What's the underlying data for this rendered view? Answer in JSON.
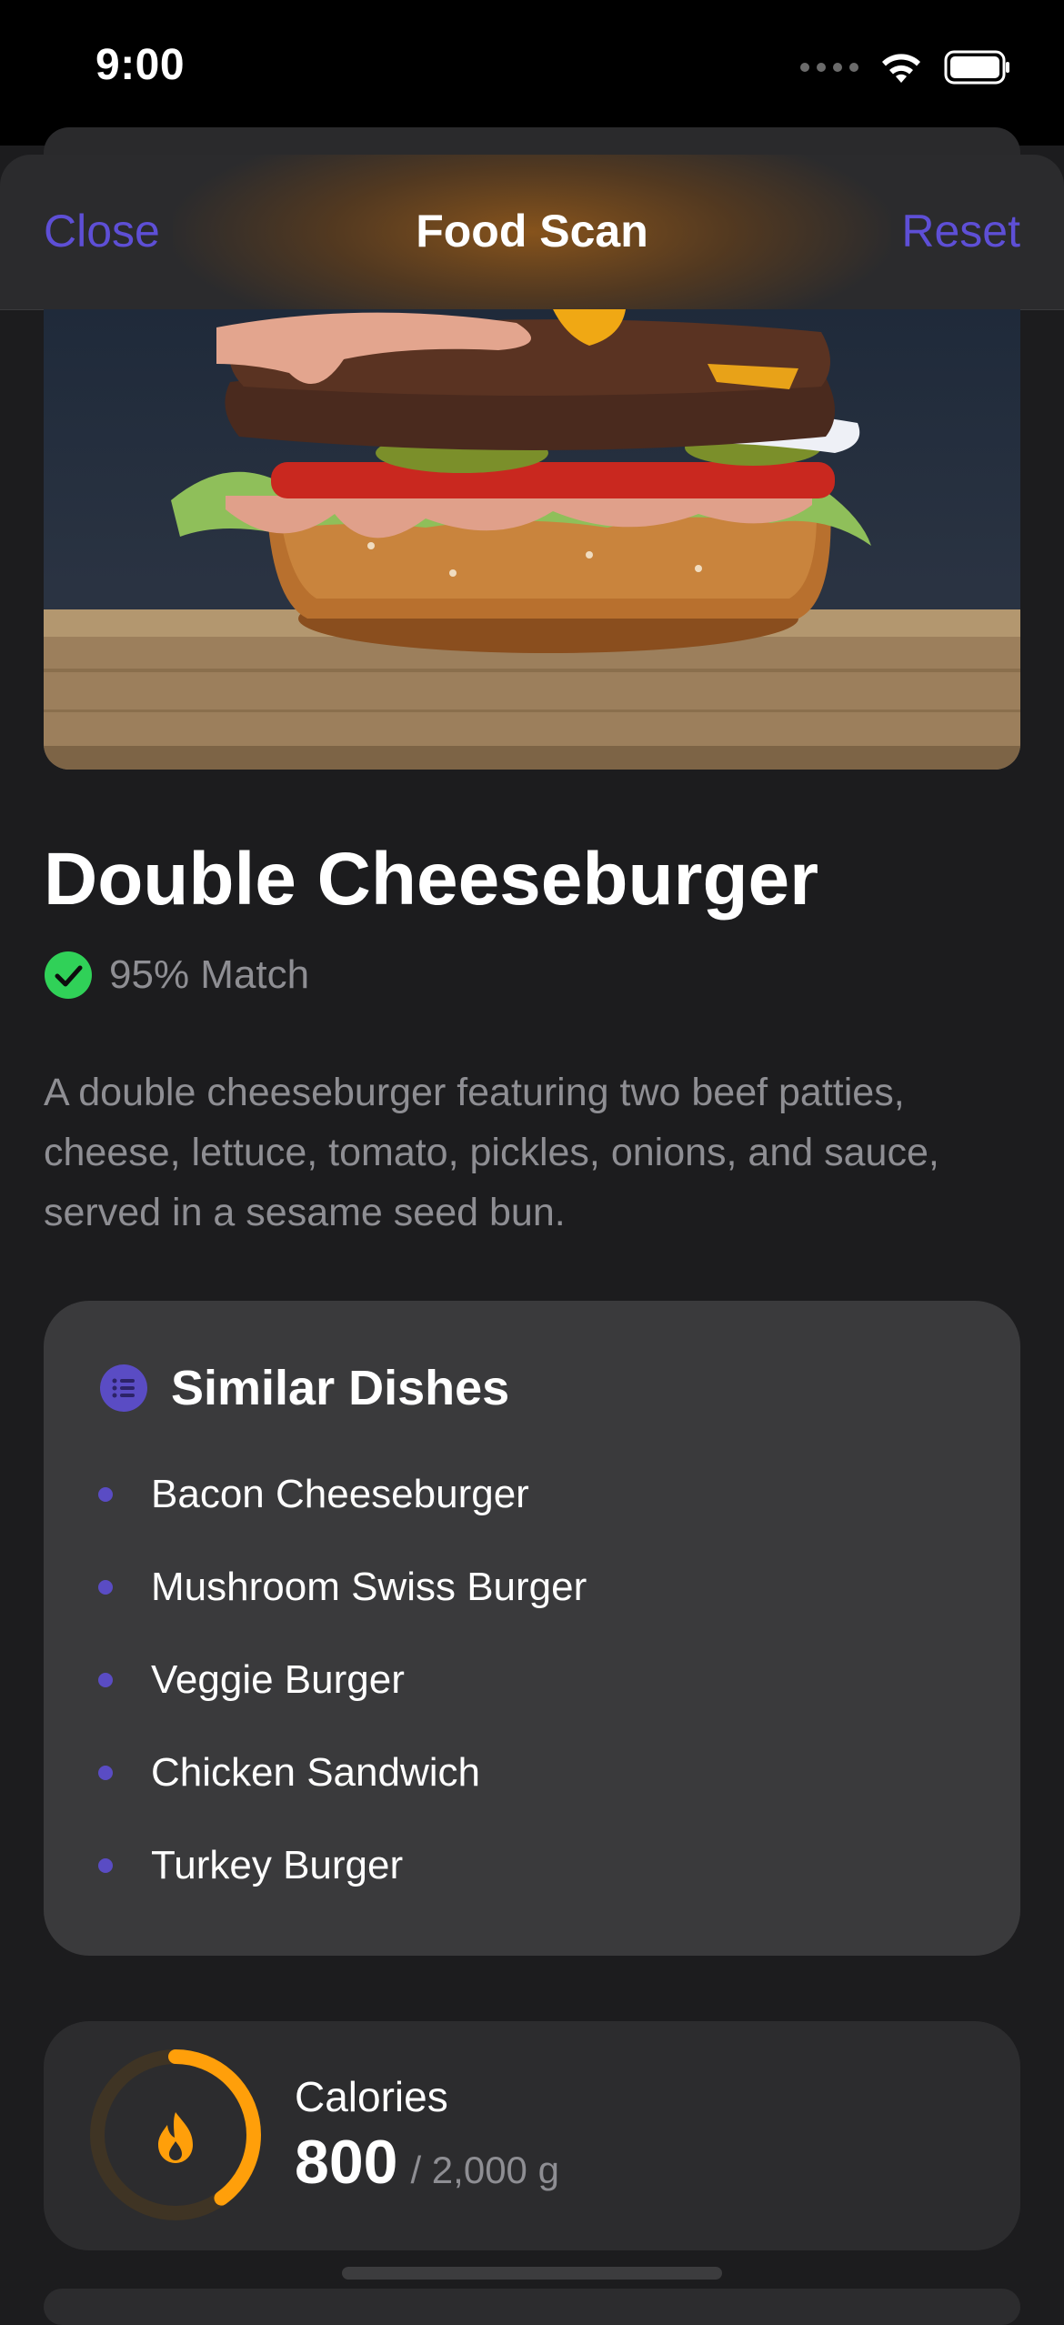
{
  "status_bar": {
    "time": "9:00"
  },
  "nav": {
    "close_label": "Close",
    "title": "Food Scan",
    "reset_label": "Reset"
  },
  "dish": {
    "name": "Double Cheeseburger",
    "match_text": "95% Match",
    "match_percent": 95,
    "description": "A double cheeseburger featuring two beef patties, cheese, lettuce, tomato, pickles, onions, and sauce, served in a sesame seed bun."
  },
  "similar": {
    "title": "Similar Dishes",
    "items": [
      "Bacon Cheeseburger",
      "Mushroom Swiss Burger",
      "Veggie Burger",
      "Chicken Sandwich",
      "Turkey Burger"
    ]
  },
  "calories": {
    "label": "Calories",
    "value": "800",
    "goal_text": "/ 2,000 g",
    "progress_fraction": 0.4
  },
  "colors": {
    "accent": "#5e4fd6",
    "match_green": "#30d158",
    "calorie_orange": "#ff9f0a"
  },
  "icons": {
    "match": "checkmark-circle-icon",
    "similar": "list-icon",
    "calories": "flame-icon"
  }
}
